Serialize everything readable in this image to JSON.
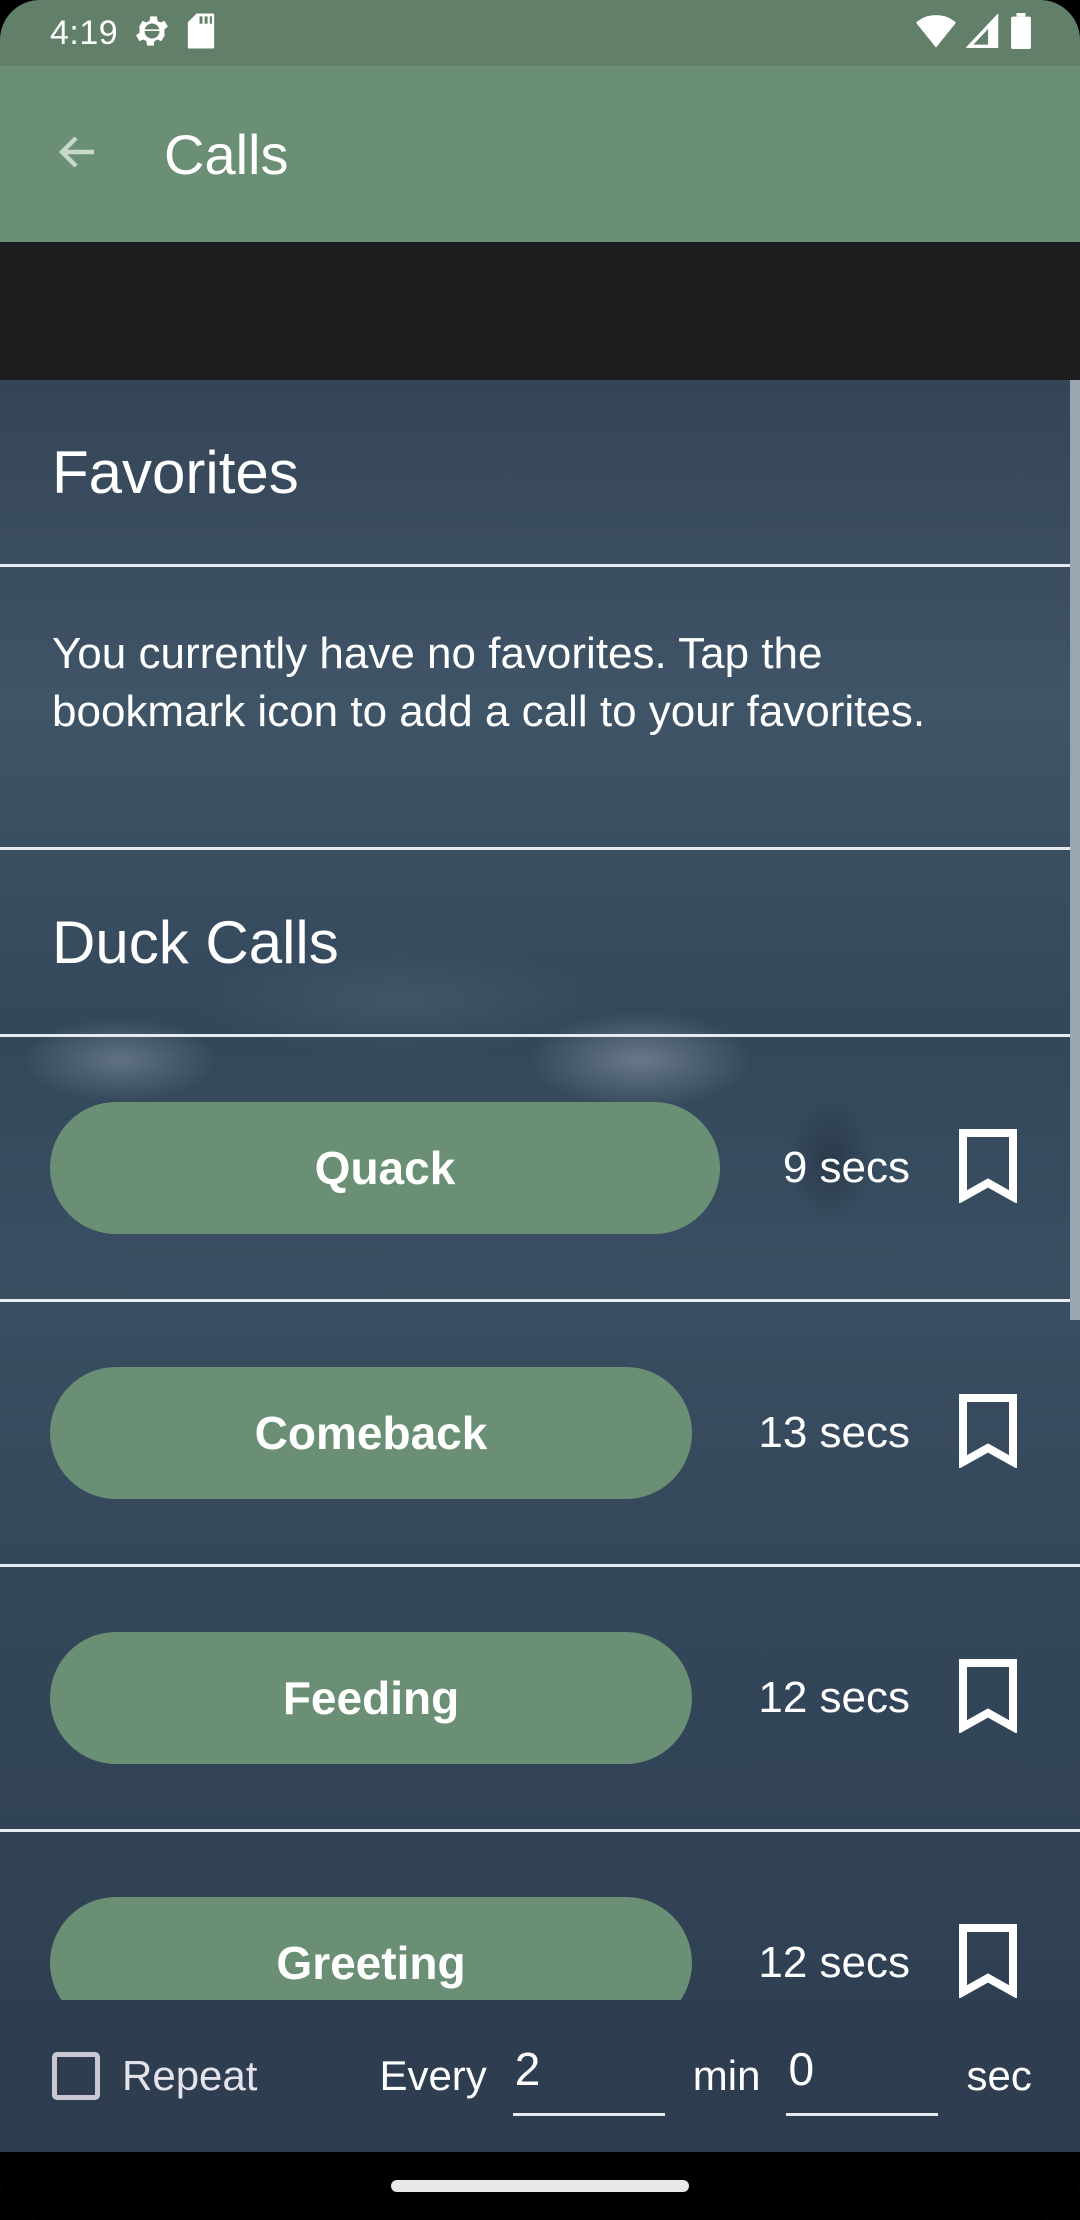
{
  "status_bar": {
    "time": "4:19",
    "icons_left": [
      "settings-gear-icon",
      "sd-card-icon"
    ],
    "icons_right": [
      "wifi-icon",
      "cell-signal-icon",
      "battery-icon"
    ]
  },
  "app_bar": {
    "back_icon": "arrow-back-icon",
    "title": "Calls"
  },
  "favorites": {
    "header": "Favorites",
    "empty_message": "You currently have no favorites. Tap the bookmark icon to add a call to your favorites."
  },
  "duck_calls": {
    "header": "Duck Calls",
    "items": [
      {
        "label": "Quack",
        "duration": "9 secs",
        "bookmarked": false
      },
      {
        "label": "Comeback",
        "duration": "13 secs",
        "bookmarked": false
      },
      {
        "label": "Feeding",
        "duration": "12 secs",
        "bookmarked": false
      },
      {
        "label": "Greeting",
        "duration": "12 secs",
        "bookmarked": false
      }
    ]
  },
  "repeat": {
    "checkbox_label": "Repeat",
    "checked": false,
    "every_label": "Every",
    "minutes_value": "2",
    "minutes_unit": "min",
    "seconds_value": "0",
    "seconds_unit": "sec"
  },
  "colors": {
    "primary_green": "#6b8f74",
    "status_green": "#627f69",
    "background_slate": "#344556",
    "divider": "#e6ebef"
  }
}
